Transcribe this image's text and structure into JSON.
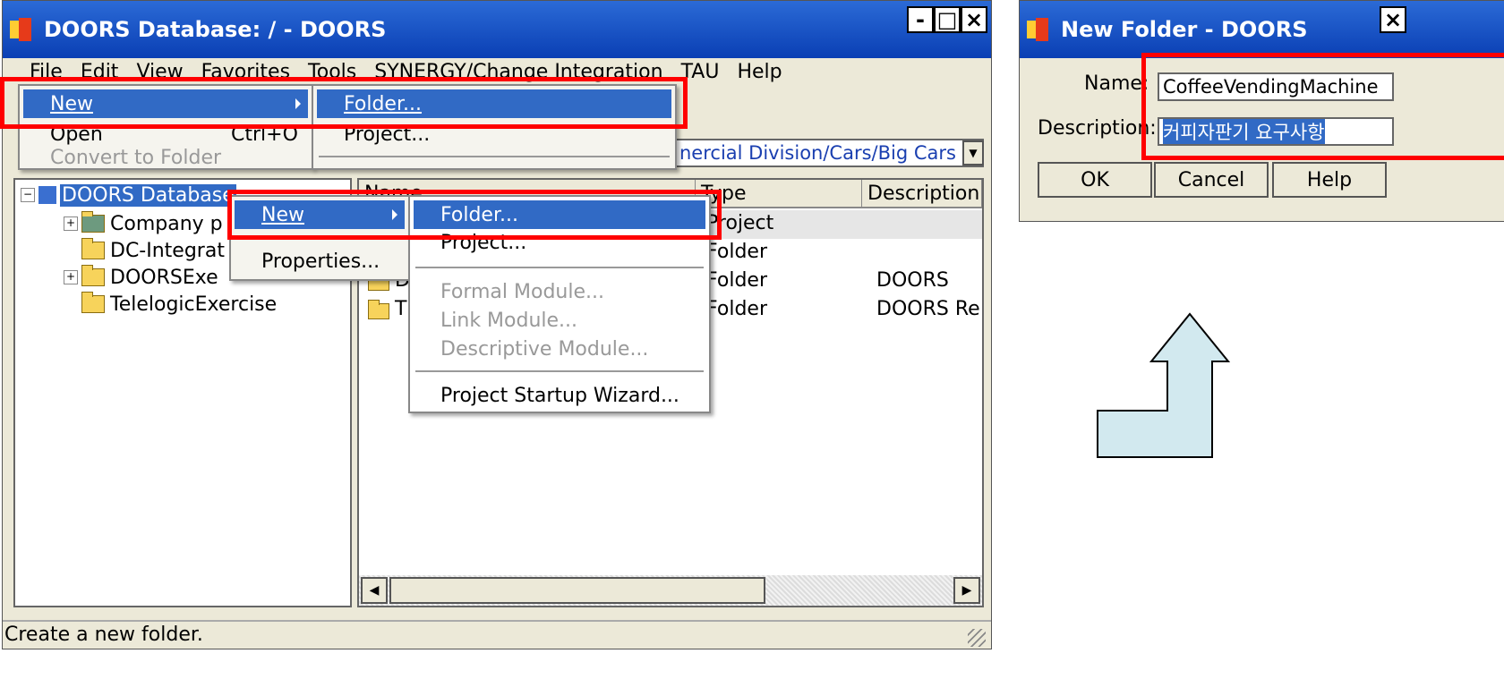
{
  "main_window": {
    "title": "DOORS Database: / - DOORS",
    "controls": {
      "minimize": "-",
      "maximize": "□",
      "close": "×"
    },
    "menubar": [
      "File",
      "Edit",
      "View",
      "Favorites",
      "Tools",
      "SYNERGY/Change Integration",
      "TAU",
      "Help"
    ],
    "path_combo": "nercial Division/Cars/Big Cars",
    "status_text": "Create a new folder."
  },
  "file_menu": {
    "items": [
      {
        "label": "New",
        "shortcut": ""
      },
      {
        "label": "Open",
        "shortcut": "Ctrl+O"
      },
      {
        "label": "Convert to Folder",
        "shortcut": ""
      }
    ]
  },
  "file_new_submenu": {
    "items": [
      "Folder...",
      "Project..."
    ]
  },
  "tree": {
    "root": "DOORS Database",
    "children": [
      "Company p",
      "DC-Integrat",
      "DOORSExe",
      "TelelogicExercise"
    ]
  },
  "list": {
    "columns": [
      "Name",
      "Type",
      "Description"
    ],
    "rows": [
      {
        "name": "",
        "type": "Project",
        "description": ""
      },
      {
        "name": "",
        "type": "Folder",
        "description": ""
      },
      {
        "name": "D",
        "type": "Folder",
        "description": "DOORS"
      },
      {
        "name": "T",
        "type": "Folder",
        "description": "DOORS Re"
      }
    ]
  },
  "context_menu": {
    "items": [
      "New",
      "Properties..."
    ]
  },
  "context_new_submenu": {
    "items": [
      "Folder...",
      "Project...",
      "Formal Module...",
      "Link Module...",
      "Descriptive Module...",
      "Project Startup Wizard..."
    ]
  },
  "dialog": {
    "title": "New Folder - DOORS",
    "close": "×",
    "name_label": "Name:",
    "name_value": "CoffeeVendingMachine",
    "description_label": "Description:",
    "description_value": "커피자판기 요구사항",
    "ok_label": "OK",
    "cancel_label": "Cancel",
    "help_label": "Help"
  },
  "colors": {
    "highlight": "#ff0000",
    "selection": "#316ac5",
    "arrow_fill": "#d2e9ef"
  }
}
